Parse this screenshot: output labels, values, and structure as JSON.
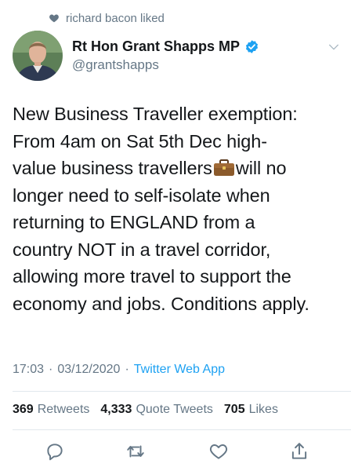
{
  "social_context": {
    "text": "richard bacon liked",
    "icon": "heart-icon"
  },
  "author": {
    "display_name": "Rt Hon Grant Shapps MP",
    "handle": "@grantshapps",
    "verified": true,
    "verified_color": "#1da1f2"
  },
  "tweet": {
    "lines": [
      "New Business Traveller exemption:",
      "From 4am on Sat 5th Dec high-",
      "value business travellers",
      "will no",
      "longer need to self-isolate when",
      "returning to ENGLAND from a",
      "country NOT in a travel corridor,",
      "allowing more travel to support the",
      "economy and jobs. Conditions apply."
    ],
    "emoji": "briefcase-icon"
  },
  "meta": {
    "time": "17:03",
    "sep1": "·",
    "date": "03/12/2020",
    "sep2": "·",
    "source": "Twitter Web App"
  },
  "stats": [
    {
      "count": "369",
      "label": "Retweets"
    },
    {
      "count": "4,333",
      "label": "Quote Tweets"
    },
    {
      "count": "705",
      "label": "Likes"
    }
  ],
  "actions": [
    "reply-icon",
    "retweet-icon",
    "like-icon",
    "share-icon"
  ],
  "colors": {
    "text": "#14171a",
    "secondary": "#657786",
    "accent": "#1da1f2",
    "divider": "#e1e8ed"
  }
}
